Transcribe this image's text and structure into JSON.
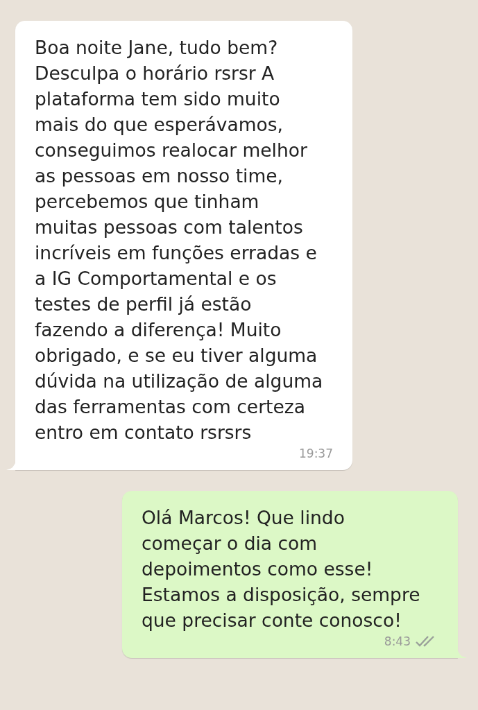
{
  "messages": [
    {
      "kind": "incoming",
      "text": "Boa noite Jane, tudo bem?\nDesculpa o horário rsrsr A\nplataforma tem sido muito\nmais do que esperávamos,\nconseguimos realocar melhor\nas pessoas em nosso time,\npercebemos que tinham\nmuitas pessoas com talentos\nincríveis em funções erradas e\na IG Comportamental e os\ntestes de perfil já estão\nfazendo a diferença! Muito\nobrigado, e se eu tiver alguma\ndúvida na utilização de alguma\ndas ferramentas com certeza\nentro em contato rsrsrs",
      "time": "19:37"
    },
    {
      "kind": "outgoing",
      "text": "Olá Marcos! Que lindo\ncomeçar o dia com\ndepoimentos como esse!\nEstamos a disposição, sempre\nque precisar conte conosco!",
      "time": "8:43",
      "read": false
    }
  ]
}
